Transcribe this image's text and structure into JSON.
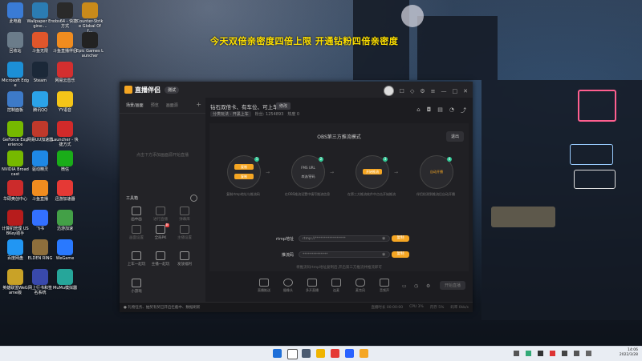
{
  "banner": "今天双倍亲密度四倍上限  开通钻粉四倍亲密度",
  "desktop_icons": [
    {
      "label": "此电脑",
      "color": "#3a7bd5"
    },
    {
      "label": "Wallpaper Engine:...",
      "color": "#2b7cb3"
    },
    {
      "label": "obs64 - 快捷方式",
      "color": "#2a2a2a"
    },
    {
      "label": "Counter-Strike Global Off...",
      "color": "#c98a1a"
    },
    {
      "label": "回收站",
      "color": "#6b7c8a"
    },
    {
      "label": "斗鱼无限",
      "color": "#e0562b"
    },
    {
      "label": "斗鱼直播伴侣",
      "color": "#f08c1f"
    },
    {
      "label": "Epic Games Launcher",
      "color": "#222"
    },
    {
      "label": "Microsoft Edge",
      "color": "#1c8fd6"
    },
    {
      "label": "Steam",
      "color": "#1b2838"
    },
    {
      "label": "网易云音乐",
      "color": "#d32f2f"
    },
    {
      "label": "控制面板",
      "color": "#3d7ac8"
    },
    {
      "label": "腾讯QQ",
      "color": "#2ba3e8"
    },
    {
      "label": "YY语音",
      "color": "#f5c518"
    },
    {
      "label": "GeForce Experience",
      "color": "#76b900"
    },
    {
      "label": "网易UU加速器",
      "color": "#c0392b"
    },
    {
      "label": "Launcher - 快捷方式",
      "color": "#d12a2a"
    },
    {
      "label": "NVIDIA Broadcast",
      "color": "#76b900"
    },
    {
      "label": "驱动精灵",
      "color": "#1e88e5"
    },
    {
      "label": "微信",
      "color": "#1aad19"
    },
    {
      "label": "华硕奥创中心",
      "color": "#cc2b2b"
    },
    {
      "label": "斗鱼直播",
      "color": "#f08c1f"
    },
    {
      "label": "迅游加速器",
      "color": "#e53935"
    },
    {
      "label": "计算机管理 USBKey助手",
      "color": "#b71c1c"
    },
    {
      "label": "飞书",
      "color": "#3370ff"
    },
    {
      "label": "迅游加速",
      "color": "#43a047"
    },
    {
      "label": "百度网盘",
      "color": "#2196f3"
    },
    {
      "label": "ELDEN RING",
      "color": "#8d6e3c"
    },
    {
      "label": "WeGame",
      "color": "#2979ff"
    },
    {
      "label": "英雄联盟WeGame版",
      "color": "#c9a227"
    },
    {
      "label": "网上行书和签名系统",
      "color": "#3949ab"
    },
    {
      "label": "MuMu模拟器",
      "color": "#26a69a"
    }
  ],
  "app": {
    "logo_text": "直播伴侣",
    "version": "测试",
    "left_tabs": [
      "场景/画面",
      "预览",
      "画面源"
    ],
    "scene_hint": "点击下方添加画面源开始直播",
    "toolbox_title": "工具箱",
    "tools": [
      {
        "label": "画中画",
        "dim": false
      },
      {
        "label": "进行直播",
        "dim": true
      },
      {
        "label": "弹幕库",
        "dim": true
      },
      {
        "label": "画面设置",
        "dim": true
      },
      {
        "label": "全局PK",
        "dim": false,
        "badge": "新"
      },
      {
        "label": "主播设置",
        "dim": true
      },
      {
        "label": "上车一起玩",
        "dim": false
      },
      {
        "label": "主播一起玩",
        "dim": false
      },
      {
        "label": "发放福利",
        "dim": false
      },
      {
        "label": "小游戏",
        "dim": false
      }
    ],
    "info": {
      "title": "钻石双倍卡、有车位、可上车",
      "edit": "修改",
      "chips": [
        "分类玩法 · 开黑上车",
        "粉丝: 1254893",
        "热度 0"
      ]
    },
    "obs": {
      "title": "OBS第三方推流模式",
      "exit": "退出",
      "steps": [
        {
          "num": "1",
          "lines": [
            "复制",
            "复制"
          ],
          "caption": "复制rtmp地址与推流码"
        },
        {
          "num": "2",
          "lines": [
            "FMS URL",
            "串流/密码"
          ],
          "caption": "在OBS推流设置中填写推流信息"
        },
        {
          "num": "3",
          "lines": [
            "开始推流"
          ],
          "caption": "在第三方推流软件中点击开始推流"
        },
        {
          "num": "4",
          "lines": [
            "自动开播"
          ],
          "caption": "伴侣检测到推流后自动开播"
        }
      ],
      "rtmp_label": "rtmp地址",
      "rtmp_value": "rtmp://*****************",
      "key_label": "推流码",
      "key_value": "**************",
      "copy_label": "复制",
      "hint": "将推流码rtmp地址复制后,开启第三方推流并推流即可"
    },
    "bottom_tools": [
      "直播推送",
      "摄像头",
      "多开直播",
      "连麦",
      "麦克风",
      "音频声"
    ],
    "start_live": "开始直播",
    "status_left": "● 礼物任务、抽奖有奖已开启拦截中、数据刷新",
    "status_right": [
      "直播时长 00:00:00",
      "CPU 3%",
      "内存 5%",
      "码率 0kb/s"
    ]
  },
  "clock": {
    "time": "14:06",
    "date": "2022/3/28"
  }
}
